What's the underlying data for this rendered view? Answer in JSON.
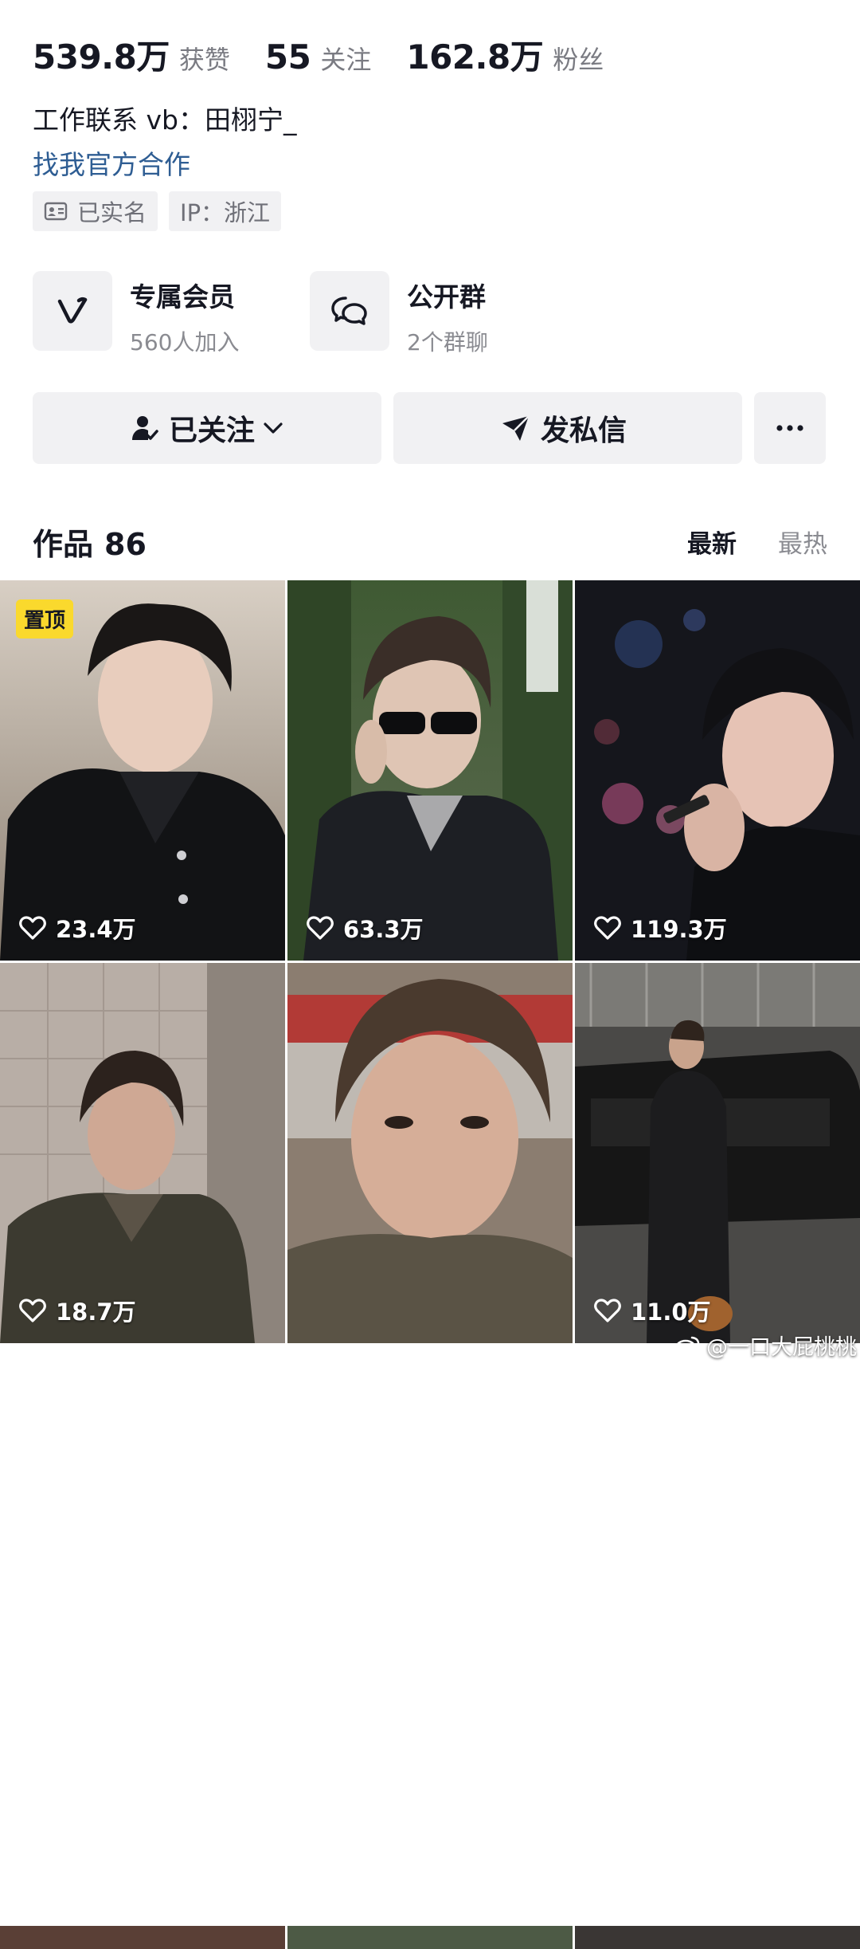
{
  "stats": [
    {
      "value": "539.8万",
      "label": "获赞"
    },
    {
      "value": "55",
      "label": "关注"
    },
    {
      "value": "162.8万",
      "label": "粉丝"
    }
  ],
  "bio": "工作联系 vb：田栩宁_",
  "business_link": "找我官方合作",
  "tags": {
    "verified": "已实名",
    "ip": "IP：浙江"
  },
  "features": {
    "membership": {
      "title": "专属会员",
      "subtitle": "560人加入"
    },
    "group": {
      "title": "公开群",
      "subtitle": "2个群聊"
    }
  },
  "actions": {
    "follow": "已关注",
    "message": "发私信"
  },
  "works": {
    "title": "作品",
    "count": "86",
    "sort_latest": "最新",
    "sort_hot": "最热"
  },
  "videos": [
    {
      "likes": "23.4万",
      "badge": "置顶"
    },
    {
      "likes": "63.3万"
    },
    {
      "likes": "119.3万"
    },
    {
      "likes": "18.7万"
    },
    {
      "likes": ""
    },
    {
      "likes": "11.0万"
    }
  ],
  "watermark": "@一口大屁桃桃",
  "colors": {
    "link": "#2e5d93",
    "pin_badge": "#fad92d",
    "chip_bg": "#f1f1f3"
  }
}
